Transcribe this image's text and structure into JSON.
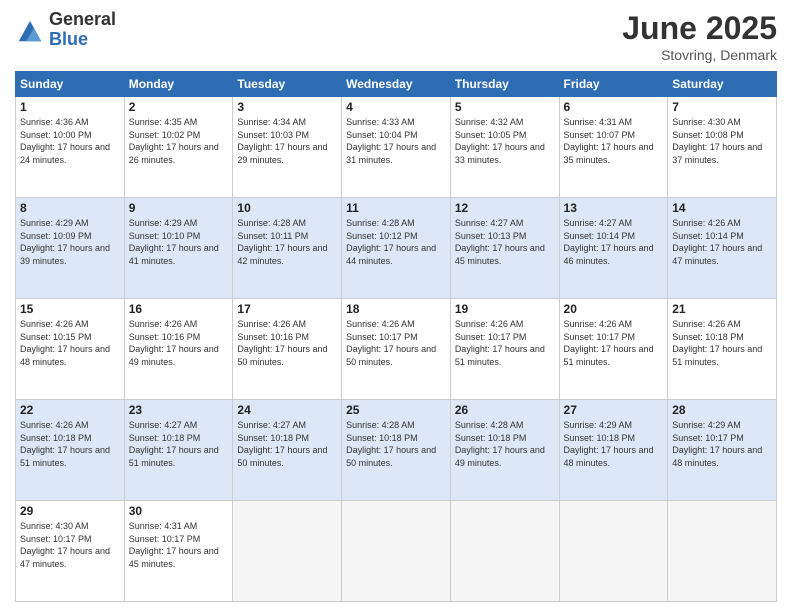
{
  "logo": {
    "general": "General",
    "blue": "Blue"
  },
  "title": "June 2025",
  "location": "Stovring, Denmark",
  "days_of_week": [
    "Sunday",
    "Monday",
    "Tuesday",
    "Wednesday",
    "Thursday",
    "Friday",
    "Saturday"
  ],
  "weeks": [
    [
      {
        "day": "1",
        "sunrise": "4:36 AM",
        "sunset": "10:00 PM",
        "daylight": "17 hours and 24 minutes."
      },
      {
        "day": "2",
        "sunrise": "4:35 AM",
        "sunset": "10:02 PM",
        "daylight": "17 hours and 26 minutes."
      },
      {
        "day": "3",
        "sunrise": "4:34 AM",
        "sunset": "10:03 PM",
        "daylight": "17 hours and 29 minutes."
      },
      {
        "day": "4",
        "sunrise": "4:33 AM",
        "sunset": "10:04 PM",
        "daylight": "17 hours and 31 minutes."
      },
      {
        "day": "5",
        "sunrise": "4:32 AM",
        "sunset": "10:05 PM",
        "daylight": "17 hours and 33 minutes."
      },
      {
        "day": "6",
        "sunrise": "4:31 AM",
        "sunset": "10:07 PM",
        "daylight": "17 hours and 35 minutes."
      },
      {
        "day": "7",
        "sunrise": "4:30 AM",
        "sunset": "10:08 PM",
        "daylight": "17 hours and 37 minutes."
      }
    ],
    [
      {
        "day": "8",
        "sunrise": "4:29 AM",
        "sunset": "10:09 PM",
        "daylight": "17 hours and 39 minutes."
      },
      {
        "day": "9",
        "sunrise": "4:29 AM",
        "sunset": "10:10 PM",
        "daylight": "17 hours and 41 minutes."
      },
      {
        "day": "10",
        "sunrise": "4:28 AM",
        "sunset": "10:11 PM",
        "daylight": "17 hours and 42 minutes."
      },
      {
        "day": "11",
        "sunrise": "4:28 AM",
        "sunset": "10:12 PM",
        "daylight": "17 hours and 44 minutes."
      },
      {
        "day": "12",
        "sunrise": "4:27 AM",
        "sunset": "10:13 PM",
        "daylight": "17 hours and 45 minutes."
      },
      {
        "day": "13",
        "sunrise": "4:27 AM",
        "sunset": "10:14 PM",
        "daylight": "17 hours and 46 minutes."
      },
      {
        "day": "14",
        "sunrise": "4:26 AM",
        "sunset": "10:14 PM",
        "daylight": "17 hours and 47 minutes."
      }
    ],
    [
      {
        "day": "15",
        "sunrise": "4:26 AM",
        "sunset": "10:15 PM",
        "daylight": "17 hours and 48 minutes."
      },
      {
        "day": "16",
        "sunrise": "4:26 AM",
        "sunset": "10:16 PM",
        "daylight": "17 hours and 49 minutes."
      },
      {
        "day": "17",
        "sunrise": "4:26 AM",
        "sunset": "10:16 PM",
        "daylight": "17 hours and 50 minutes."
      },
      {
        "day": "18",
        "sunrise": "4:26 AM",
        "sunset": "10:17 PM",
        "daylight": "17 hours and 50 minutes."
      },
      {
        "day": "19",
        "sunrise": "4:26 AM",
        "sunset": "10:17 PM",
        "daylight": "17 hours and 51 minutes."
      },
      {
        "day": "20",
        "sunrise": "4:26 AM",
        "sunset": "10:17 PM",
        "daylight": "17 hours and 51 minutes."
      },
      {
        "day": "21",
        "sunrise": "4:26 AM",
        "sunset": "10:18 PM",
        "daylight": "17 hours and 51 minutes."
      }
    ],
    [
      {
        "day": "22",
        "sunrise": "4:26 AM",
        "sunset": "10:18 PM",
        "daylight": "17 hours and 51 minutes."
      },
      {
        "day": "23",
        "sunrise": "4:27 AM",
        "sunset": "10:18 PM",
        "daylight": "17 hours and 51 minutes."
      },
      {
        "day": "24",
        "sunrise": "4:27 AM",
        "sunset": "10:18 PM",
        "daylight": "17 hours and 50 minutes."
      },
      {
        "day": "25",
        "sunrise": "4:28 AM",
        "sunset": "10:18 PM",
        "daylight": "17 hours and 50 minutes."
      },
      {
        "day": "26",
        "sunrise": "4:28 AM",
        "sunset": "10:18 PM",
        "daylight": "17 hours and 49 minutes."
      },
      {
        "day": "27",
        "sunrise": "4:29 AM",
        "sunset": "10:18 PM",
        "daylight": "17 hours and 48 minutes."
      },
      {
        "day": "28",
        "sunrise": "4:29 AM",
        "sunset": "10:17 PM",
        "daylight": "17 hours and 48 minutes."
      }
    ],
    [
      {
        "day": "29",
        "sunrise": "4:30 AM",
        "sunset": "10:17 PM",
        "daylight": "17 hours and 47 minutes."
      },
      {
        "day": "30",
        "sunrise": "4:31 AM",
        "sunset": "10:17 PM",
        "daylight": "17 hours and 45 minutes."
      },
      null,
      null,
      null,
      null,
      null
    ]
  ]
}
